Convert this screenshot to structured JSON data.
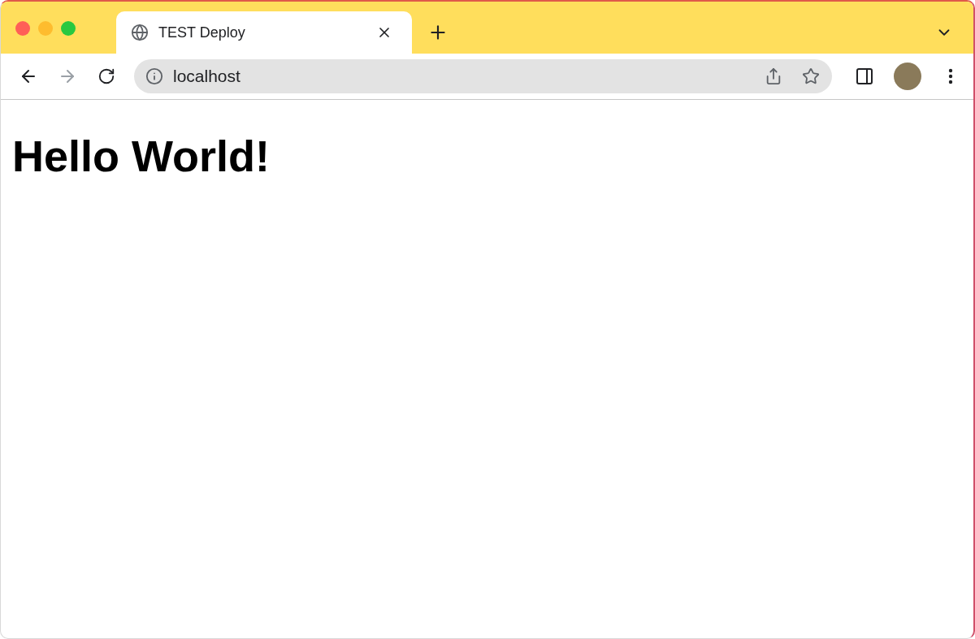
{
  "tabs": [
    {
      "title": "TEST Deploy",
      "selected": true
    }
  ],
  "toolbar": {
    "nav": [
      {
        "kind": "back",
        "disabled": false
      },
      {
        "kind": "forward",
        "disabled": true
      },
      {
        "kind": "reload",
        "disabled": false
      }
    ],
    "address": "localhost"
  },
  "page": {
    "heading": "Hello World!"
  }
}
